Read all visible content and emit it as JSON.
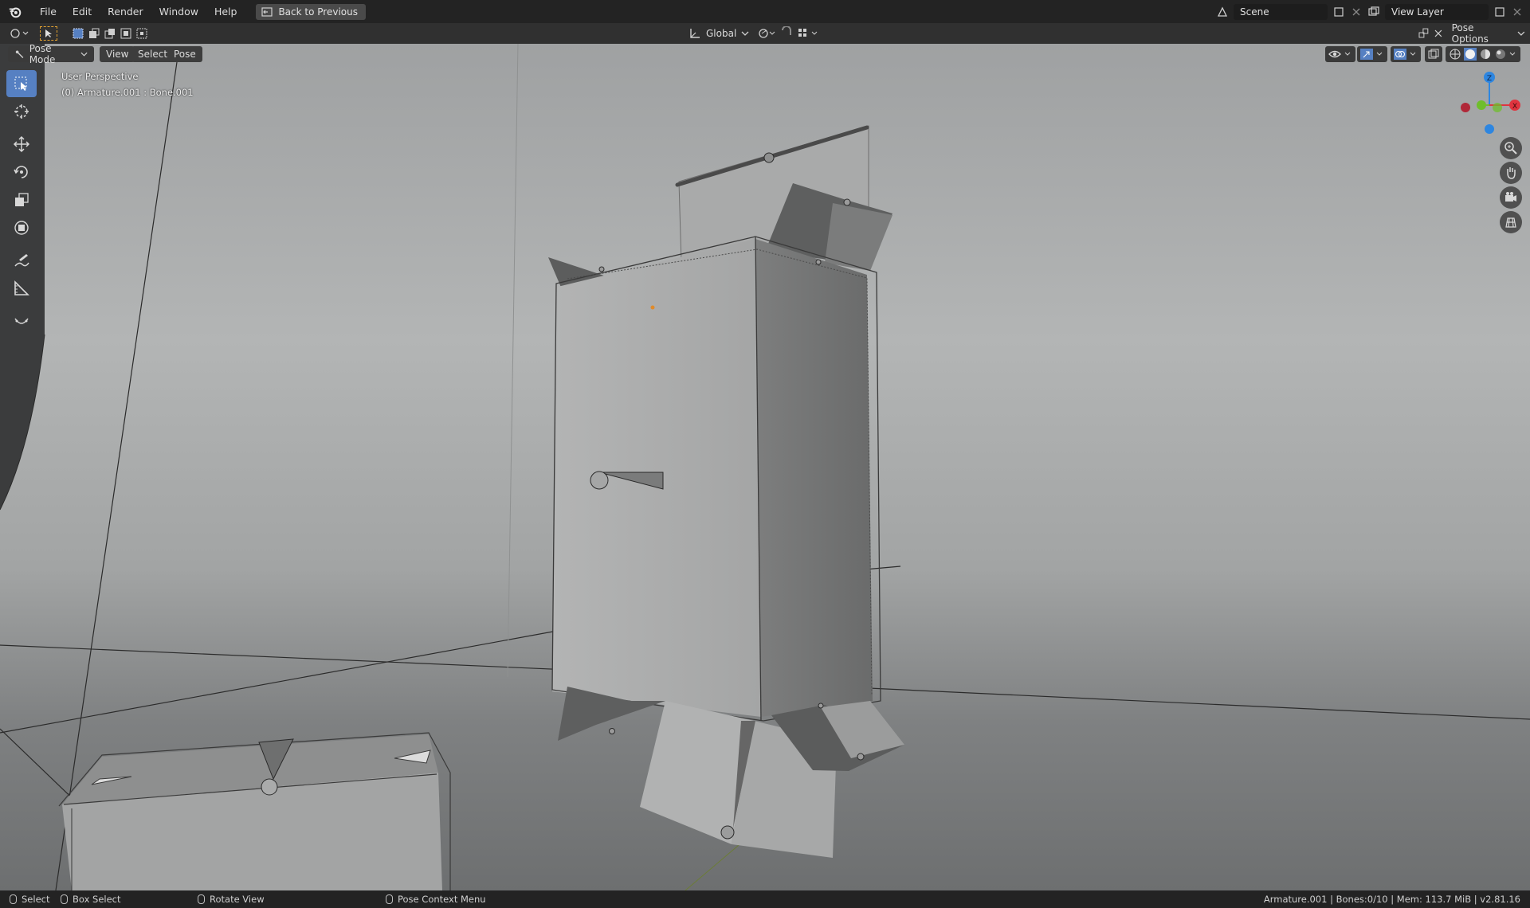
{
  "menu": {
    "items": [
      "File",
      "Edit",
      "Render",
      "Window",
      "Help"
    ],
    "back_label": "Back to Previous"
  },
  "scene": {
    "label": "Scene",
    "view_layer": "View Layer"
  },
  "header": {
    "transform_orientation": "Global",
    "pose_options": "Pose Options"
  },
  "viewport_header": {
    "mode": "Pose Mode",
    "view": "View",
    "select": "Select",
    "pose": "Pose"
  },
  "overlay": {
    "perspective": "User Perspective",
    "object_info": "(0) Armature.001 : Bone.001"
  },
  "gizmo": {
    "z": "Z",
    "y": "Y",
    "x": "X"
  },
  "status": {
    "select": "Select",
    "box_select": "Box Select",
    "rotate_view": "Rotate View",
    "context_menu": "Pose Context Menu",
    "stats": "Armature.001 | Bones:0/10 | Mem: 113.7 MiB | v2.81.16"
  },
  "colors": {
    "topbar": "#232323",
    "active_tool": "#5680c2",
    "axis_x": "#e0343f",
    "axis_y": "#6fbe2b",
    "axis_z": "#2e86e0"
  },
  "icons": {
    "tools": [
      "select-box-icon",
      "cursor-icon",
      "move-icon",
      "rotate-icon",
      "scale-icon",
      "transform-icon",
      "annotate-icon",
      "measure-icon",
      "relax-icon"
    ],
    "nav": [
      "zoom-icon",
      "pan-icon",
      "camera-icon",
      "grid-icon"
    ]
  }
}
